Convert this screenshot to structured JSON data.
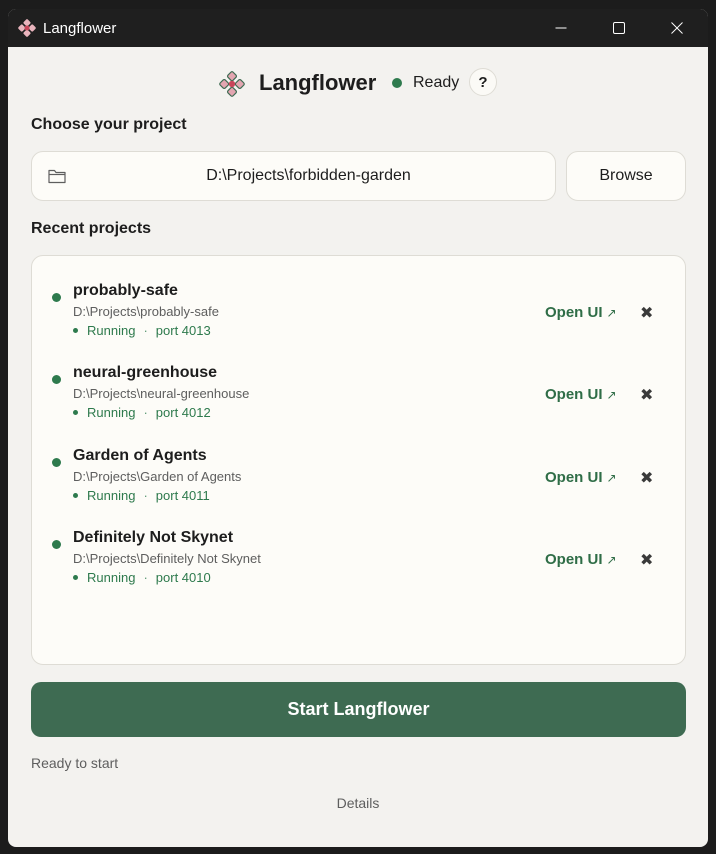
{
  "window": {
    "title": "Langflower",
    "icon": "flower-logo-icon"
  },
  "header": {
    "brand": "Langflower",
    "status": "Ready",
    "help_label": "?"
  },
  "choose": {
    "label": "Choose your project",
    "path": "D:\\Projects\\forbidden-garden",
    "browse_label": "Browse"
  },
  "recent": {
    "label": "Recent projects",
    "open_label": "Open UI",
    "open_arrow": "↗",
    "remove_label": "✖",
    "items": [
      {
        "name": "probably-safe",
        "path": "D:\\Projects\\probably-safe",
        "state": "Running",
        "port": "port 4013"
      },
      {
        "name": "neural-greenhouse",
        "path": "D:\\Projects\\neural-greenhouse",
        "state": "Running",
        "port": "port 4012"
      },
      {
        "name": "Garden of Agents",
        "path": "D:\\Projects\\Garden of Agents",
        "state": "Running",
        "port": "port 4011"
      },
      {
        "name": "Definitely Not Skynet",
        "path": "D:\\Projects\\Definitely Not Skynet",
        "state": "Running",
        "port": "port 4010"
      }
    ]
  },
  "start_label": "Start Langflower",
  "status_text": "Ready to start",
  "details_label": "Details",
  "colors": {
    "accent": "#3e6b52",
    "running": "#2e7a4d",
    "background": "#f3f2ef"
  }
}
